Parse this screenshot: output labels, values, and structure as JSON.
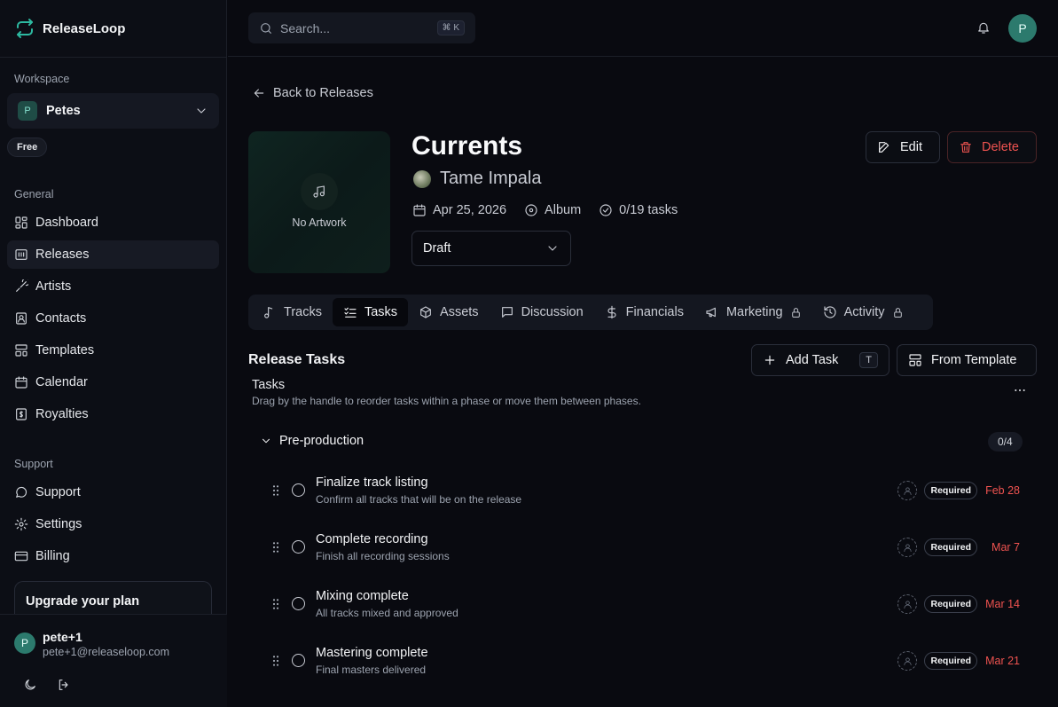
{
  "app": {
    "name": "ReleaseLoop"
  },
  "sidebar": {
    "workspace_label": "Workspace",
    "workspace": {
      "initial": "P",
      "name": "Petes"
    },
    "plan_badge": "Free",
    "general_label": "General",
    "general_items": [
      {
        "label": "Dashboard",
        "icon": "dashboard-icon"
      },
      {
        "label": "Releases",
        "icon": "releases-icon",
        "active": true
      },
      {
        "label": "Artists",
        "icon": "artists-icon"
      },
      {
        "label": "Contacts",
        "icon": "contacts-icon"
      },
      {
        "label": "Templates",
        "icon": "templates-icon"
      },
      {
        "label": "Calendar",
        "icon": "calendar-icon"
      },
      {
        "label": "Royalties",
        "icon": "royalties-icon"
      }
    ],
    "support_label": "Support",
    "support_items": [
      {
        "label": "Support",
        "icon": "chat-icon"
      },
      {
        "label": "Settings",
        "icon": "gear-icon"
      },
      {
        "label": "Billing",
        "icon": "credit-card-icon"
      }
    ],
    "upgrade_title": "Upgrade your plan",
    "user": {
      "initial": "P",
      "name": "pete+1",
      "email": "pete+1@releaseloop.com"
    }
  },
  "topbar": {
    "search_placeholder": "Search...",
    "search_shortcut": "⌘ K",
    "avatar_initial": "P"
  },
  "release": {
    "back_label": "Back to Releases",
    "artwork_label": "No Artwork",
    "title": "Currents",
    "artist": "Tame Impala",
    "date": "Apr 25, 2026",
    "type": "Album",
    "tasks_progress": "0/19 tasks",
    "status": "Draft",
    "edit_label": "Edit",
    "delete_label": "Delete"
  },
  "tabs": [
    {
      "label": "Tracks",
      "icon": "music-note-icon"
    },
    {
      "label": "Tasks",
      "icon": "checklist-icon",
      "active": true
    },
    {
      "label": "Assets",
      "icon": "box-icon"
    },
    {
      "label": "Discussion",
      "icon": "message-icon"
    },
    {
      "label": "Financials",
      "icon": "dollar-icon"
    },
    {
      "label": "Marketing",
      "icon": "megaphone-icon",
      "locked": true
    },
    {
      "label": "Activity",
      "icon": "history-icon",
      "locked": true
    }
  ],
  "tasks_section": {
    "title": "Release Tasks",
    "add_task_label": "Add Task",
    "add_task_shortcut": "T",
    "from_template_label": "From Template",
    "heading": "Tasks",
    "hint": "Drag by the handle to reorder tasks within a phase or move them between phases.",
    "phase": {
      "name": "Pre-production",
      "count": "0/4"
    },
    "tasks": [
      {
        "title": "Finalize track listing",
        "desc": "Confirm all tracks that will be on the release",
        "badge": "Required",
        "due": "Feb 28"
      },
      {
        "title": "Complete recording",
        "desc": "Finish all recording sessions",
        "badge": "Required",
        "due": "Mar 7"
      },
      {
        "title": "Mixing complete",
        "desc": "All tracks mixed and approved",
        "badge": "Required",
        "due": "Mar 14"
      },
      {
        "title": "Mastering complete",
        "desc": "Final masters delivered",
        "badge": "Required",
        "due": "Mar 21"
      }
    ]
  },
  "colors": {
    "accent": "#2db8a0",
    "danger": "#ef5350",
    "background": "#090a10"
  }
}
